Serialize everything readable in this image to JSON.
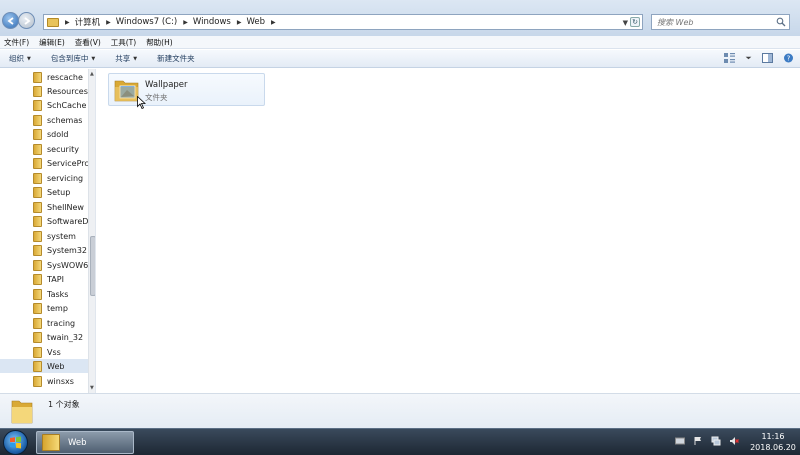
{
  "address_bar": {
    "crumbs": [
      "计算机",
      "Windows7 (C:)",
      "Windows",
      "Web"
    ],
    "search_placeholder": "搜索 Web"
  },
  "menu": [
    "文件(F)",
    "编辑(E)",
    "查看(V)",
    "工具(T)",
    "帮助(H)"
  ],
  "toolbar": {
    "organize": "组织",
    "include_library": "包含到库中",
    "share": "共享",
    "new_folder": "新建文件夹"
  },
  "nav_tree": {
    "items": [
      "rescache",
      "Resources",
      "SchCache",
      "schemas",
      "sdold",
      "security",
      "ServicePrc",
      "servicing",
      "Setup",
      "ShellNew",
      "SoftwareD",
      "system",
      "System32",
      "SysWOW6",
      "TAPI",
      "Tasks",
      "temp",
      "tracing",
      "twain_32",
      "Vss",
      "Web",
      "winsxs"
    ],
    "selected": "Web"
  },
  "content": {
    "items": [
      {
        "name": "Wallpaper",
        "type": "文件夹"
      }
    ]
  },
  "details": {
    "count_text": "1 个对象"
  },
  "taskbar": {
    "window_label": "Web",
    "time": "11:16",
    "date": "2018.06.20"
  },
  "colors": {
    "folder": "#e8c35a",
    "selection": "#dbe6f3",
    "taskbar": "#1d2733",
    "accent": "#2f6db5"
  }
}
